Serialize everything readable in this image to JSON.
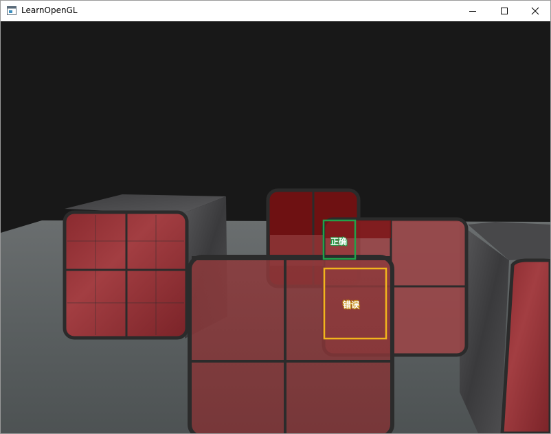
{
  "window": {
    "title": "LearnOpenGL",
    "controls": {
      "minimize": "minimize-icon",
      "maximize": "maximize-icon",
      "close": "close-icon"
    }
  },
  "annotations": {
    "correct": {
      "label": "正确",
      "color": "#22a24a"
    },
    "wrong": {
      "label": "错误",
      "color": "#f2b51c"
    }
  },
  "colors": {
    "background": "#181818",
    "floor": "#5e6364",
    "marble": "#4b4b4d",
    "window_tint": "#8c2b2e",
    "window_frame": "#2b2b2b"
  }
}
